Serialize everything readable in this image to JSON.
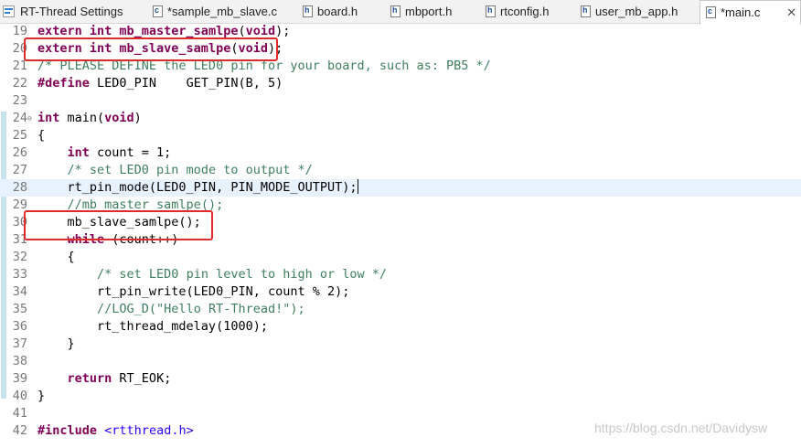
{
  "tabs": [
    {
      "label": "RT-Thread Settings",
      "icon": "rt-thread-settings-icon",
      "active": false
    },
    {
      "label": "*sample_mb_slave.c",
      "icon": "c-source-file-icon",
      "badge": "c",
      "active": false
    },
    {
      "label": "board.h",
      "icon": "c-header-file-icon",
      "badge": "h",
      "active": false
    },
    {
      "label": "mbport.h",
      "icon": "c-header-file-icon",
      "badge": "h",
      "active": false
    },
    {
      "label": "rtconfig.h",
      "icon": "c-header-file-icon",
      "badge": "h",
      "active": false
    },
    {
      "label": "user_mb_app.h",
      "icon": "c-header-file-icon",
      "badge": "h",
      "active": false
    },
    {
      "label": "*main.c",
      "icon": "c-source-file-icon",
      "badge": "c",
      "active": true,
      "close": "✕"
    }
  ],
  "editor": {
    "lines": [
      {
        "n": "19",
        "seg": [
          [
            "kw",
            "extern int "
          ],
          [
            "kw",
            "mb_master_samlpe"
          ],
          [
            "t",
            "("
          ],
          [
            "kw",
            "void"
          ],
          [
            "t",
            ");"
          ]
        ]
      },
      {
        "n": "20",
        "seg": [
          [
            "kw",
            "extern int "
          ],
          [
            "kw",
            "mb_slave_samlpe"
          ],
          [
            "t",
            "("
          ],
          [
            "kw",
            "void"
          ],
          [
            "t",
            ");"
          ]
        ]
      },
      {
        "n": "21",
        "seg": [
          [
            "cm",
            "/* PLEASE DEFINE the LED0 pin for your board, such as: PB5 */"
          ]
        ]
      },
      {
        "n": "22",
        "seg": [
          [
            "kw",
            "#define"
          ],
          [
            "t",
            " LED0_PIN    GET_PIN(B, 5)"
          ]
        ]
      },
      {
        "n": "23",
        "seg": []
      },
      {
        "n": "24",
        "seg": [
          [
            "kw",
            "int "
          ],
          [
            "t",
            "main("
          ],
          [
            "kw",
            "void"
          ],
          [
            "t",
            ")"
          ]
        ]
      },
      {
        "n": "25",
        "seg": [
          [
            "t",
            "{"
          ]
        ]
      },
      {
        "n": "26",
        "seg": [
          [
            "t",
            "    "
          ],
          [
            "kw",
            "int"
          ],
          [
            "t",
            " count = 1;"
          ]
        ]
      },
      {
        "n": "27",
        "seg": [
          [
            "t",
            "    "
          ],
          [
            "cm",
            "/* set LED0 pin mode to output */"
          ]
        ]
      },
      {
        "n": "28",
        "seg": [
          [
            "t",
            "    rt_pin_mode(LED0_PIN, PIN_MODE_OUTPUT);"
          ]
        ]
      },
      {
        "n": "29",
        "seg": [
          [
            "t",
            "    "
          ],
          [
            "cm",
            "//mb_master_samlpe();"
          ]
        ]
      },
      {
        "n": "30",
        "seg": [
          [
            "t",
            "    mb_slave_samlpe();"
          ]
        ]
      },
      {
        "n": "31",
        "seg": [
          [
            "t",
            "    "
          ],
          [
            "kw",
            "while"
          ],
          [
            "t",
            " (count++)"
          ]
        ]
      },
      {
        "n": "32",
        "seg": [
          [
            "t",
            "    {"
          ]
        ]
      },
      {
        "n": "33",
        "seg": [
          [
            "t",
            "        "
          ],
          [
            "cm",
            "/* set LED0 pin level to high or low */"
          ]
        ]
      },
      {
        "n": "34",
        "seg": [
          [
            "t",
            "        rt_pin_write(LED0_PIN, count % 2);"
          ]
        ]
      },
      {
        "n": "35",
        "seg": [
          [
            "t",
            "        "
          ],
          [
            "cm",
            "//LOG_D(\"Hello RT-Thread!\");"
          ]
        ]
      },
      {
        "n": "36",
        "seg": [
          [
            "t",
            "        rt_thread_mdelay(1000);"
          ]
        ]
      },
      {
        "n": "37",
        "seg": [
          [
            "t",
            "    }"
          ]
        ]
      },
      {
        "n": "38",
        "seg": []
      },
      {
        "n": "39",
        "seg": [
          [
            "t",
            "    "
          ],
          [
            "kw",
            "return"
          ],
          [
            "t",
            " RT_EOK;"
          ]
        ]
      },
      {
        "n": "40",
        "seg": [
          [
            "t",
            "}"
          ]
        ]
      },
      {
        "n": "41",
        "seg": []
      },
      {
        "n": "42",
        "seg": [
          [
            "kw",
            "#include"
          ],
          [
            "t",
            " "
          ],
          [
            "inc",
            "<rtthread.h>"
          ]
        ]
      }
    ],
    "current_line": "28",
    "fold_marker_line": "24",
    "fold_glyph": "⊖"
  },
  "watermark": "https://blog.csdn.net/Davidysw",
  "colors": {
    "keyword": "#7f0055",
    "comment": "#3f7f5f",
    "include_string": "#2a00ff",
    "annotation_box": "#e02b2b",
    "current_line_bg": "#e8f2fe",
    "change_bar": "#c7e3ec"
  }
}
